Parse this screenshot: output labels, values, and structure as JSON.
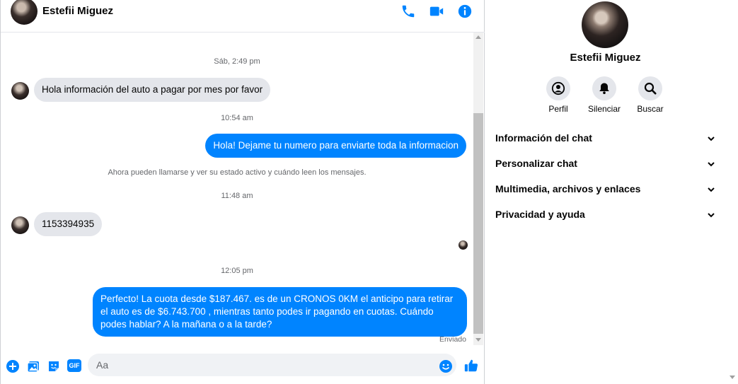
{
  "header": {
    "contact_name": "Estefii Miguez",
    "icons": [
      "phone-icon",
      "video-icon",
      "info-icon"
    ]
  },
  "messages": {
    "ts1": "Sáb, 2:49 pm",
    "m1": "Hola información del auto a pagar por mes por favor",
    "ts2": "10:54 am",
    "m2": "Hola! Dejame tu numero  para enviarte toda la informacion",
    "system": "Ahora pueden llamarse y ver su estado activo y cuándo leen los mensajes.",
    "ts3": "11:48 am",
    "m3": "1153394935",
    "ts4": "12:05 pm",
    "m4": "Perfecto! La cuota desde $187.467. es de un CRONOS 0KM el anticipo para retirar el auto es de $6.743.700 , mientras tanto podes ir pagando en cuotas. Cuándo podes hablar? A la mañana o a la tarde?",
    "status": "Enviado"
  },
  "composer": {
    "placeholder": "Aa",
    "icons": [
      "plus-icon",
      "image-icon",
      "sticker-icon",
      "gif-icon",
      "emoji-icon",
      "like-icon"
    ],
    "gif_label": "GIF"
  },
  "details": {
    "name": "Estefii Miguez",
    "actions": [
      {
        "label": "Perfil",
        "icon": "profile-icon"
      },
      {
        "label": "Silenciar",
        "icon": "bell-icon"
      },
      {
        "label": "Buscar",
        "icon": "search-icon"
      }
    ],
    "sections": [
      "Información del chat",
      "Personalizar chat",
      "Multimedia, archivos y enlaces",
      "Privacidad y ayuda"
    ]
  },
  "colors": {
    "accent": "#0084ff",
    "incoming_bubble": "#e4e6eb",
    "secondary_text": "#65676b"
  }
}
